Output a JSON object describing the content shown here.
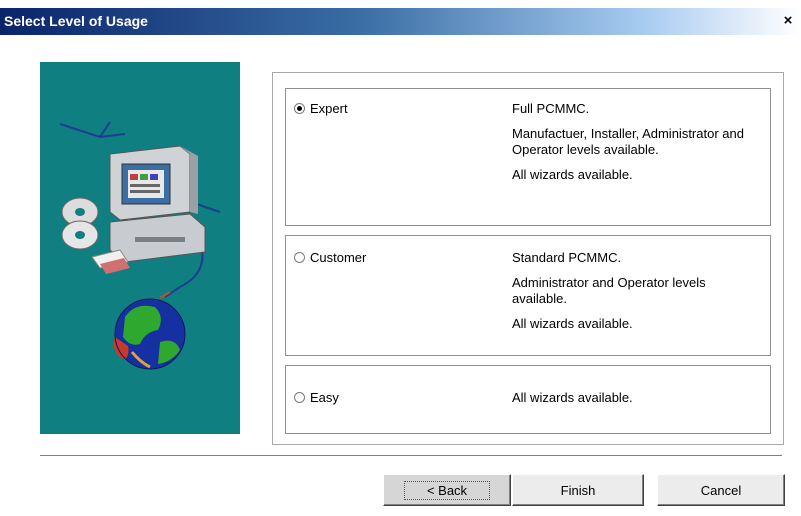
{
  "window": {
    "title": "Select Level of Usage",
    "close_glyph": "×",
    "close_icon": "close-icon"
  },
  "illustration": {
    "background_color": "#107f82",
    "icons": [
      "computer-icon",
      "cd-disc-icon",
      "globe-icon"
    ]
  },
  "options": [
    {
      "label": "Expert",
      "selected": true,
      "descriptions": [
        "Full PCMMC.",
        "Manufactuer, Installer, Administrator and Operator levels available.",
        "All wizards available."
      ]
    },
    {
      "label": "Customer",
      "selected": false,
      "descriptions": [
        "Standard PCMMC.",
        "Administrator and Operator levels available.",
        "All wizards available."
      ]
    },
    {
      "label": "Easy",
      "selected": false,
      "descriptions": [
        "All wizards available."
      ]
    }
  ],
  "buttons": {
    "back_prefix": "< ",
    "back_label": "Back",
    "finish_label": "Finish",
    "cancel_label": "Cancel"
  },
  "colors": {
    "title_gradient_start": "#0a246a",
    "title_gradient_end": "#a6caf0",
    "button_face": "#ececec"
  }
}
